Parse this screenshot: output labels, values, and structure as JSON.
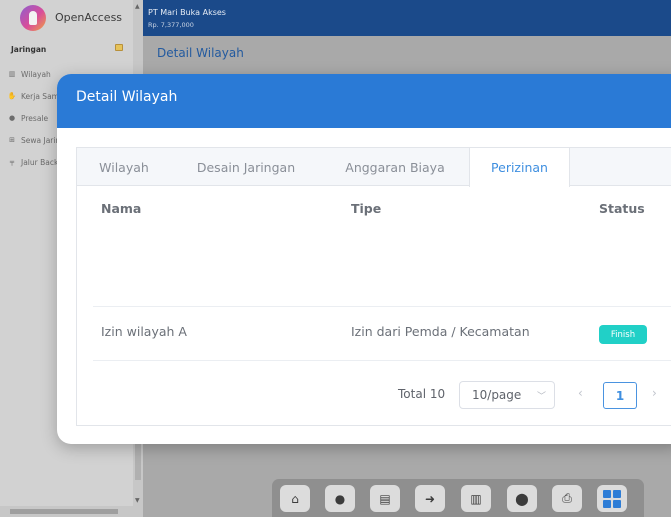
{
  "app": {
    "logo_text": "OpenAccess"
  },
  "topbar": {
    "company_name": "PT Mari Buka Akses",
    "balance": "Rp. 7,377,000"
  },
  "sidebar": {
    "section_label": "Jaringan",
    "items": [
      {
        "label": "Wilayah",
        "icon": "map-icon"
      },
      {
        "label": "Kerja Sama",
        "icon": "handshake-icon"
      },
      {
        "label": "Presale",
        "icon": "location-pin-icon"
      },
      {
        "label": "Sewa Jaringan",
        "icon": "cart-icon"
      },
      {
        "label": "Jalur Backbone",
        "icon": "signpost-icon"
      }
    ]
  },
  "page": {
    "title": "Detail Wilayah"
  },
  "modal": {
    "title": "Detail Wilayah",
    "tabs": [
      {
        "label": "Wilayah"
      },
      {
        "label": "Desain Jaringan"
      },
      {
        "label": "Anggaran Biaya"
      },
      {
        "label": "Perizinan",
        "active": true
      }
    ],
    "table": {
      "columns": [
        "Nama",
        "Tipe",
        "Status"
      ],
      "rows": [
        {
          "nama": "Izin wilayah A",
          "tipe": "Izin dari Pemda / Kecamatan",
          "status": "Finish"
        }
      ]
    },
    "pagination": {
      "total": "Total 10",
      "page_size": "10/page",
      "current_page": "1"
    }
  },
  "dock": {
    "buttons": [
      {
        "icon": "home-icon"
      },
      {
        "icon": "user-icon"
      },
      {
        "icon": "card-icon"
      },
      {
        "icon": "user-transfer-icon"
      },
      {
        "icon": "map-icon"
      },
      {
        "icon": "location-pin-icon"
      },
      {
        "icon": "printer-icon"
      },
      {
        "icon": "grid-icon",
        "selected": true
      }
    ]
  },
  "colors": {
    "topbar": "#1b4a8a",
    "modal_header": "#2a7ad6",
    "accent": "#3f8fe0",
    "status_finish": "#21d0c7"
  }
}
